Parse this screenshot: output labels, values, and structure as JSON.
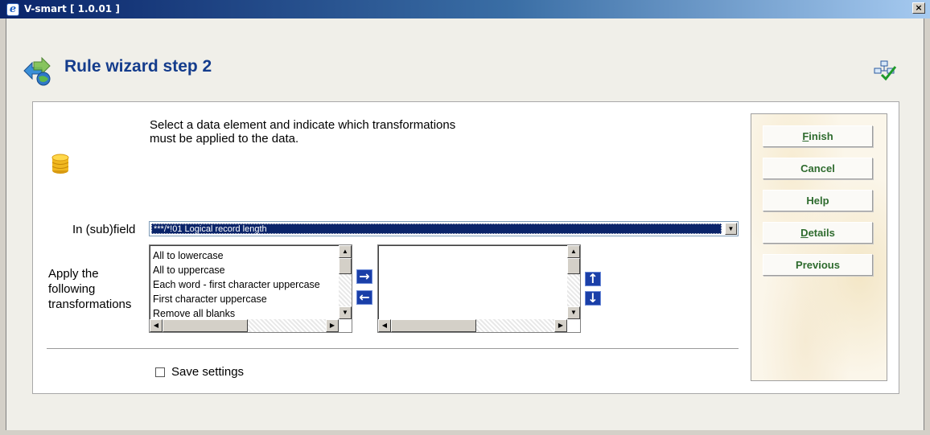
{
  "window": {
    "title": "V-smart [ 1.0.01 ]",
    "close_glyph": "×"
  },
  "page": {
    "title": "Rule wizard step 2"
  },
  "form": {
    "instruction_line1": "Select a data element and indicate which transformations",
    "instruction_line2": "must be applied to the data.",
    "subfield_label": "In (sub)field",
    "subfield_value": "***/*!01 Logical record length",
    "apply_label_line1": "Apply the",
    "apply_label_line2": "following",
    "apply_label_line3": "transformations",
    "available_transformations": [
      "All to lowercase",
      "All to uppercase",
      "Each word - first character uppercase",
      "First character uppercase",
      "Remove all blanks"
    ],
    "selected_transformations": [],
    "save_settings_label": "Save settings",
    "save_settings_checked": false
  },
  "buttons": {
    "finish": {
      "accel": "F",
      "rest": "inish"
    },
    "cancel": "Cancel",
    "help": "Help",
    "details": {
      "accel": "D",
      "rest": "etails"
    },
    "previous": "Previous",
    "add_glyph": "→",
    "remove_glyph": "←",
    "up_glyph": "↑",
    "down_glyph": "↓"
  },
  "icons": {
    "app": "ie-icon",
    "header": "rule-wizard-icon",
    "corner": "workflow-check-icon",
    "data": "database-icon"
  },
  "colors": {
    "title_blue": "#143c8c",
    "button_text_green": "#2e6b2e",
    "arrow_button_blue": "#1a3fa8",
    "selection_navy": "#0a246a"
  }
}
